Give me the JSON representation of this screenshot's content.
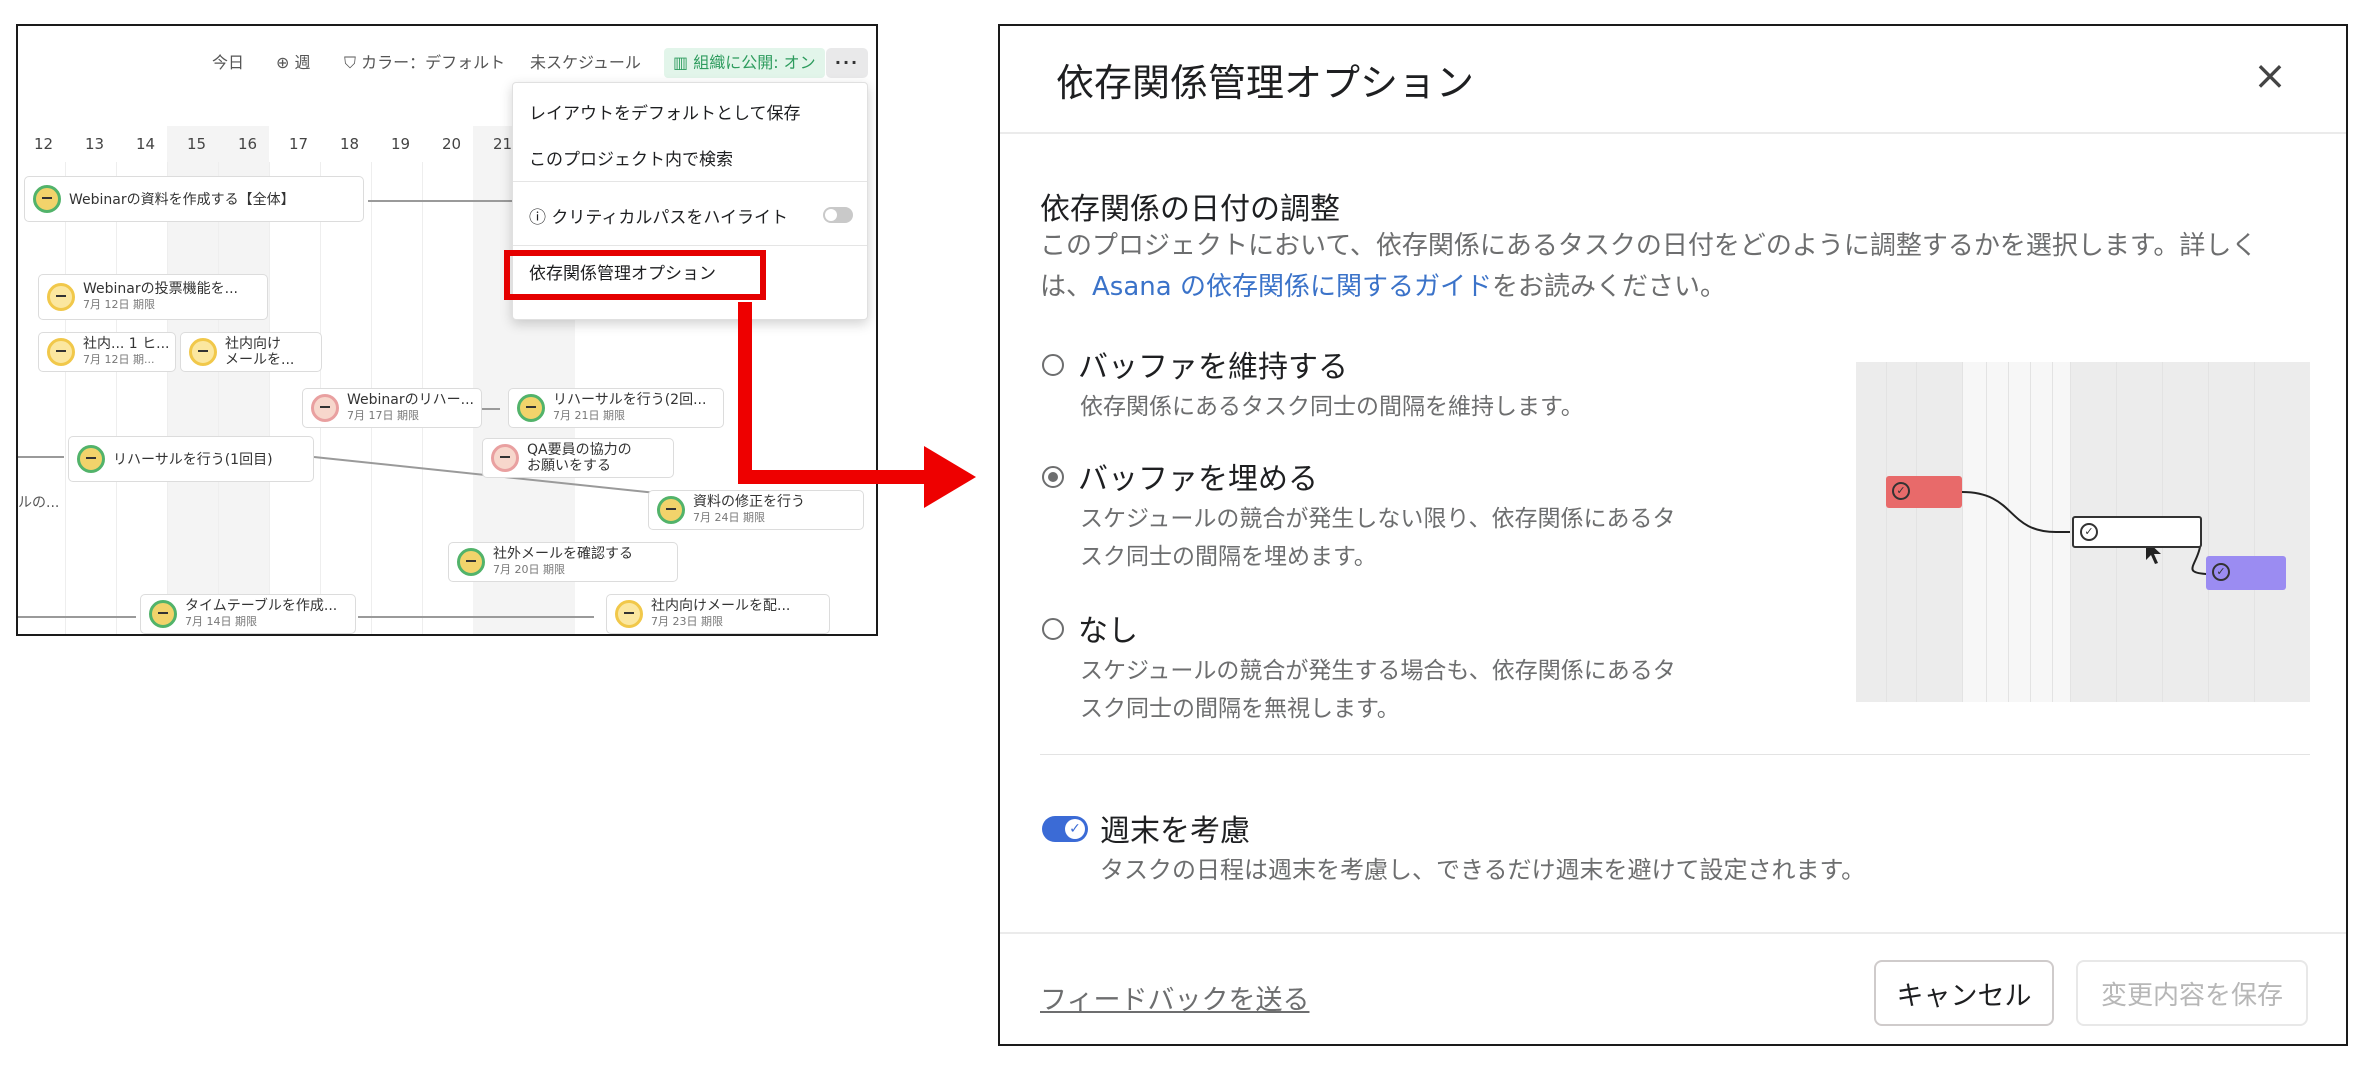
{
  "toolbar": {
    "today": "今日",
    "week": "週",
    "color": "カラー：デフォルト",
    "unscheduled": "未スケジュール",
    "published": "組織に公開: オン",
    "more": "···"
  },
  "timeline": {
    "days": [
      "12",
      "13",
      "14",
      "15",
      "16",
      "17",
      "18",
      "19",
      "20",
      "21"
    ],
    "tasks": [
      {
        "title": "Webinarの資料を作成する【全体】",
        "due": ""
      },
      {
        "title": "Webinarの投票機能を...",
        "due": "7月 12日 期限"
      },
      {
        "title": "社内...  1 ヒ...",
        "due": "7月 12日 期..."
      },
      {
        "title": "社内向け",
        "due": "メールを..."
      },
      {
        "title": "Webinarのリハー...",
        "due": "7月 17日 期限"
      },
      {
        "title": "リハーサルを行う(2回...",
        "due": "7月 21日 期限"
      },
      {
        "title": "リハーサルを行う(1回目)",
        "due": ""
      },
      {
        "title": "QA要員の協力の",
        "due": "お願いをする"
      },
      {
        "title": "資料の修正を行う",
        "due": "7月 24日 期限"
      },
      {
        "title": "社外メールを確認する",
        "due": "7月 20日 期限"
      },
      {
        "title": "タイムテーブルを作成...",
        "due": "7月 14日 期限"
      },
      {
        "title": "社内向けメールを配...",
        "due": "7月 23日 期限"
      }
    ],
    "edge_label": "ルの..."
  },
  "menu": {
    "save_layout": "レイアウトをデフォルトとして保存",
    "search_project": "このプロジェクト内で検索",
    "critical_path": "クリティカルパスをハイライト",
    "dependency_options": "依存関係管理オプション"
  },
  "dialog": {
    "title": "依存関係管理オプション",
    "section_title": "依存関係の日付の調整",
    "description_pre": "このプロジェクトにおいて、依存関係にあるタスクの日付をどのように調整するかを選択します。詳しくは、",
    "description_link": "Asana の依存関係に関するガイド",
    "description_post": "をお読みください。",
    "options": [
      {
        "label": "バッファを維持する",
        "desc": "依存関係にあるタスク同士の間隔を維持します。",
        "checked": false
      },
      {
        "label": "バッファを埋める",
        "desc": "スケジュールの競合が発生しない限り、依存関係にあるタスク同士の間隔を埋めます。",
        "checked": true
      },
      {
        "label": "なし",
        "desc": "スケジュールの競合が発生する場合も、依存関係にあるタスク同士の間隔を無視します。",
        "checked": false
      }
    ],
    "weekend_label": "週末を考慮",
    "weekend_desc": "タスクの日程は週末を考慮し、できるだけ週末を避けて設定されます。",
    "weekend_on": true,
    "feedback": "フィードバックを送る",
    "cancel": "キャンセル",
    "save": "変更内容を保存"
  },
  "colors": {
    "highlight_red": "#ee0000",
    "accent_blue": "#3b6bd6",
    "link_blue": "#3b73c9",
    "task_red": "#e86a6a",
    "task_purple": "#9b8cf2",
    "published_green": "#2e9c5e"
  },
  "icons": {
    "week": "zoom-icon",
    "color": "tag-icon",
    "published": "building-icon",
    "critical_path": "info-icon",
    "close": "close-icon"
  }
}
